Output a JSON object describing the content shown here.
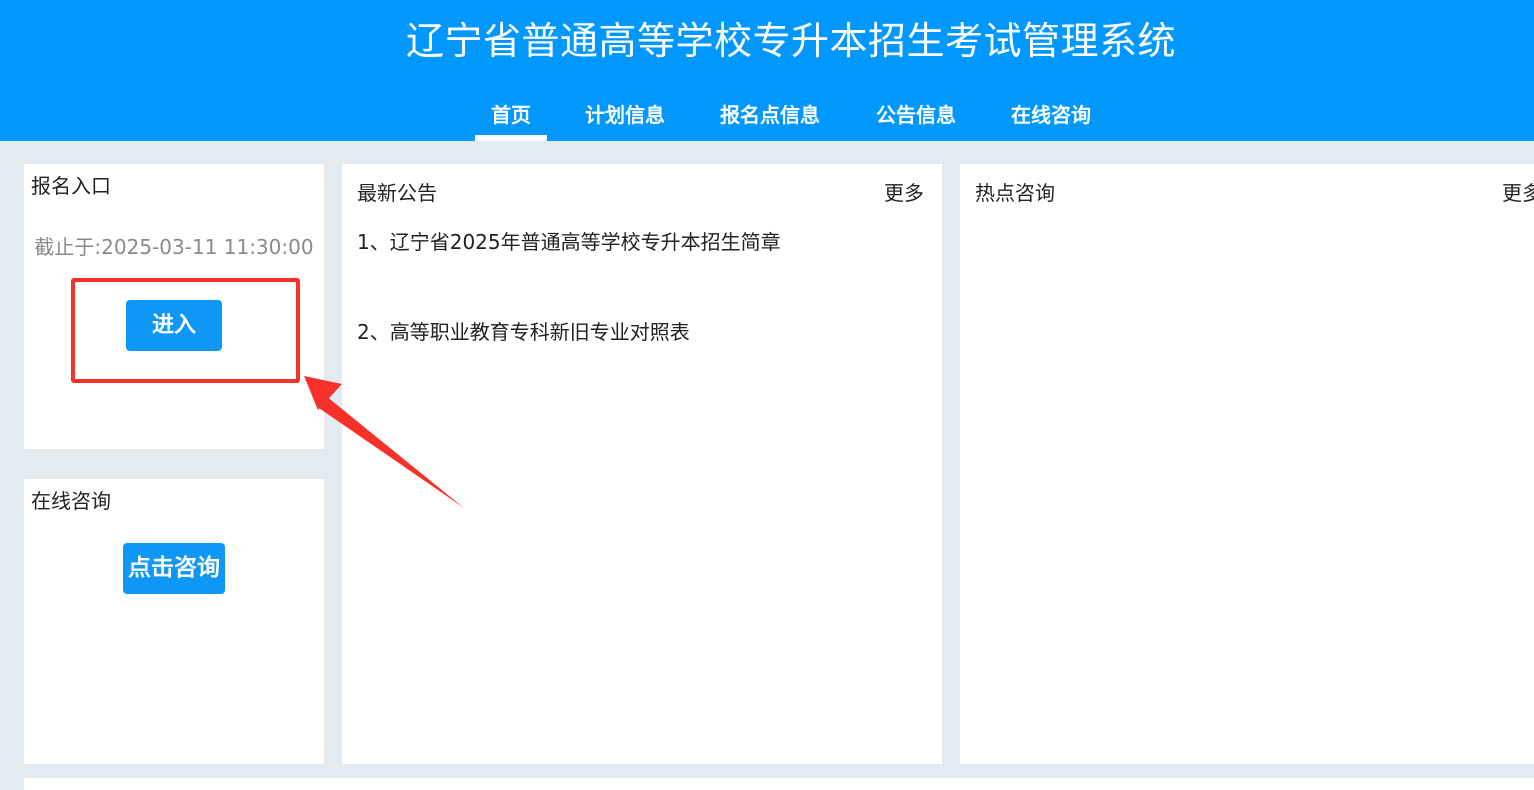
{
  "header": {
    "title": "辽宁省普通高等学校专升本招生考试管理系统",
    "nav": [
      {
        "label": "首页",
        "active": true
      },
      {
        "label": "计划信息",
        "active": false
      },
      {
        "label": "报名点信息",
        "active": false
      },
      {
        "label": "公告信息",
        "active": false
      },
      {
        "label": "在线咨询",
        "active": false
      }
    ]
  },
  "registration": {
    "title": "报名入口",
    "deadline": "截止于:2025-03-11 11:30:00",
    "enter_label": "进入"
  },
  "consult": {
    "title": "在线咨询",
    "button_label": "点击咨询"
  },
  "notices": {
    "title": "最新公告",
    "more_label": "更多",
    "items": [
      "1、辽宁省2025年普通高等学校专升本招生简章",
      "2、高等职业教育专科新旧专业对照表"
    ]
  },
  "hot": {
    "title": "热点咨询",
    "more_label": "更多"
  },
  "colors": {
    "header_bg": "#0098ff",
    "button_bg": "#0f97f5",
    "annotation_red": "#f5312a",
    "page_bg": "#e4ebf0"
  }
}
